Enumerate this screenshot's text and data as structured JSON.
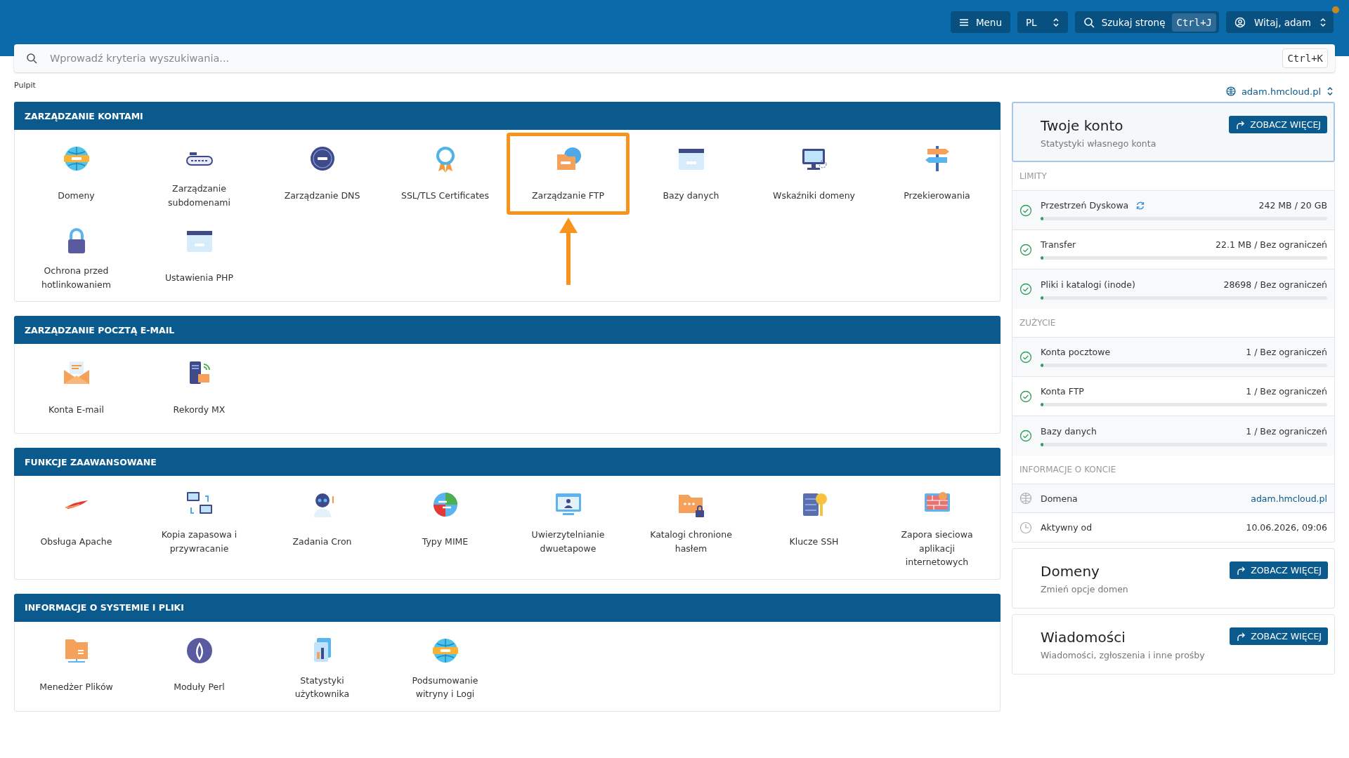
{
  "header": {
    "menu_button": "Menu",
    "language": "PL",
    "page_search": {
      "label": "Szukaj stronę",
      "shortcut": "Ctrl+J"
    },
    "user_menu": {
      "label": "Witaj, adam",
      "notification": true
    }
  },
  "search": {
    "placeholder": "Wprowadź kryteria wyszukiwania...",
    "shortcut": "Ctrl+K"
  },
  "breadcrumb": "Pulpit",
  "domain_selector": "adam.hmcloud.pl",
  "sections": [
    {
      "title": "ZARZĄDZANIE KONTAMI",
      "items": [
        {
          "label": "Domeny",
          "highlighted": false
        },
        {
          "label": "Zarządzanie subdomenami",
          "highlighted": false
        },
        {
          "label": "Zarządzanie DNS",
          "highlighted": false
        },
        {
          "label": "SSL/TLS Certificates",
          "highlighted": false
        },
        {
          "label": "Zarządzanie FTP",
          "highlighted": true
        },
        {
          "label": "Bazy danych",
          "highlighted": false
        },
        {
          "label": "Wskaźniki domeny",
          "highlighted": false
        },
        {
          "label": "Przekierowania",
          "highlighted": false
        },
        {
          "label": "Ochrona przed hotlinkowaniem",
          "highlighted": false
        },
        {
          "label": "Ustawienia PHP",
          "highlighted": false
        }
      ]
    },
    {
      "title": "ZARZĄDZANIE POCZTĄ E-MAIL",
      "items": [
        {
          "label": "Konta E-mail",
          "highlighted": false
        },
        {
          "label": "Rekordy MX",
          "highlighted": false
        }
      ]
    },
    {
      "title": "FUNKCJE ZAAWANSOWANE",
      "items": [
        {
          "label": "Obsługa Apache",
          "highlighted": false
        },
        {
          "label": "Kopia zapasowa i przywracanie",
          "highlighted": false
        },
        {
          "label": "Zadania Cron",
          "highlighted": false
        },
        {
          "label": "Typy MIME",
          "highlighted": false
        },
        {
          "label": "Uwierzytelnianie dwuetapowe",
          "highlighted": false
        },
        {
          "label": "Katalogi chronione hasłem",
          "highlighted": false
        },
        {
          "label": "Klucze SSH",
          "highlighted": false
        },
        {
          "label": "Zapora sieciowa aplikacji internetowych",
          "highlighted": false
        }
      ]
    },
    {
      "title": "INFORMACJE O SYSTEMIE I PLIKI",
      "items": [
        {
          "label": "Menedżer Plików",
          "highlighted": false
        },
        {
          "label": "Moduły Perl",
          "highlighted": false
        },
        {
          "label": "Statystyki użytkownika",
          "highlighted": false
        },
        {
          "label": "Podsumowanie witryny i Logi",
          "highlighted": false
        }
      ]
    }
  ],
  "sidebar": {
    "account_card": {
      "title": "Twoje konto",
      "subtitle": "Statystyki własnego konta",
      "button": "ZOBACZ WIĘCEJ",
      "selected": true
    },
    "stats": [
      {
        "heading": "LIMITY",
        "rows": [
          {
            "kind": "meter",
            "label": "Przestrzeń Dyskowa",
            "value": "242 MB / 20 GB",
            "level": 0.01,
            "refresh": true
          },
          {
            "kind": "meter",
            "label": "Transfer",
            "value": "22.1 MB / Bez ograniczeń",
            "level": 0.01,
            "refresh": false
          },
          {
            "kind": "meter",
            "label": "Pliki i katalogi (inode)",
            "value": "28698 / Bez ograniczeń",
            "level": 0.01,
            "refresh": false
          }
        ]
      },
      {
        "heading": "ZUŻYCIE",
        "rows": [
          {
            "kind": "meter",
            "label": "Konta pocztowe",
            "value": "1 / Bez ograniczeń",
            "level": 0.01,
            "refresh": false
          },
          {
            "kind": "meter",
            "label": "Konta FTP",
            "value": "1 / Bez ograniczeń",
            "level": 0.01,
            "refresh": false
          },
          {
            "kind": "meter",
            "label": "Bazy danych",
            "value": "1 / Bez ograniczeń",
            "level": 0.01,
            "refresh": false
          }
        ]
      },
      {
        "heading": "INFORMACJE O KONCIE",
        "rows": [
          {
            "kind": "info",
            "label": "Domena",
            "value": "adam.hmcloud.pl",
            "link": true
          },
          {
            "kind": "info",
            "label": "Aktywny od",
            "value": "10.06.2026, 09:06",
            "link": false
          }
        ]
      }
    ],
    "cards": [
      {
        "title": "Domeny",
        "subtitle": "Zmień opcje domen",
        "button": "ZOBACZ WIĘCEJ",
        "selected": false
      },
      {
        "title": "Wiadomości",
        "subtitle": "Wiadomości, zgłoszenia i inne prośby",
        "button": "ZOBACZ WIĘCEJ",
        "selected": false
      }
    ]
  }
}
